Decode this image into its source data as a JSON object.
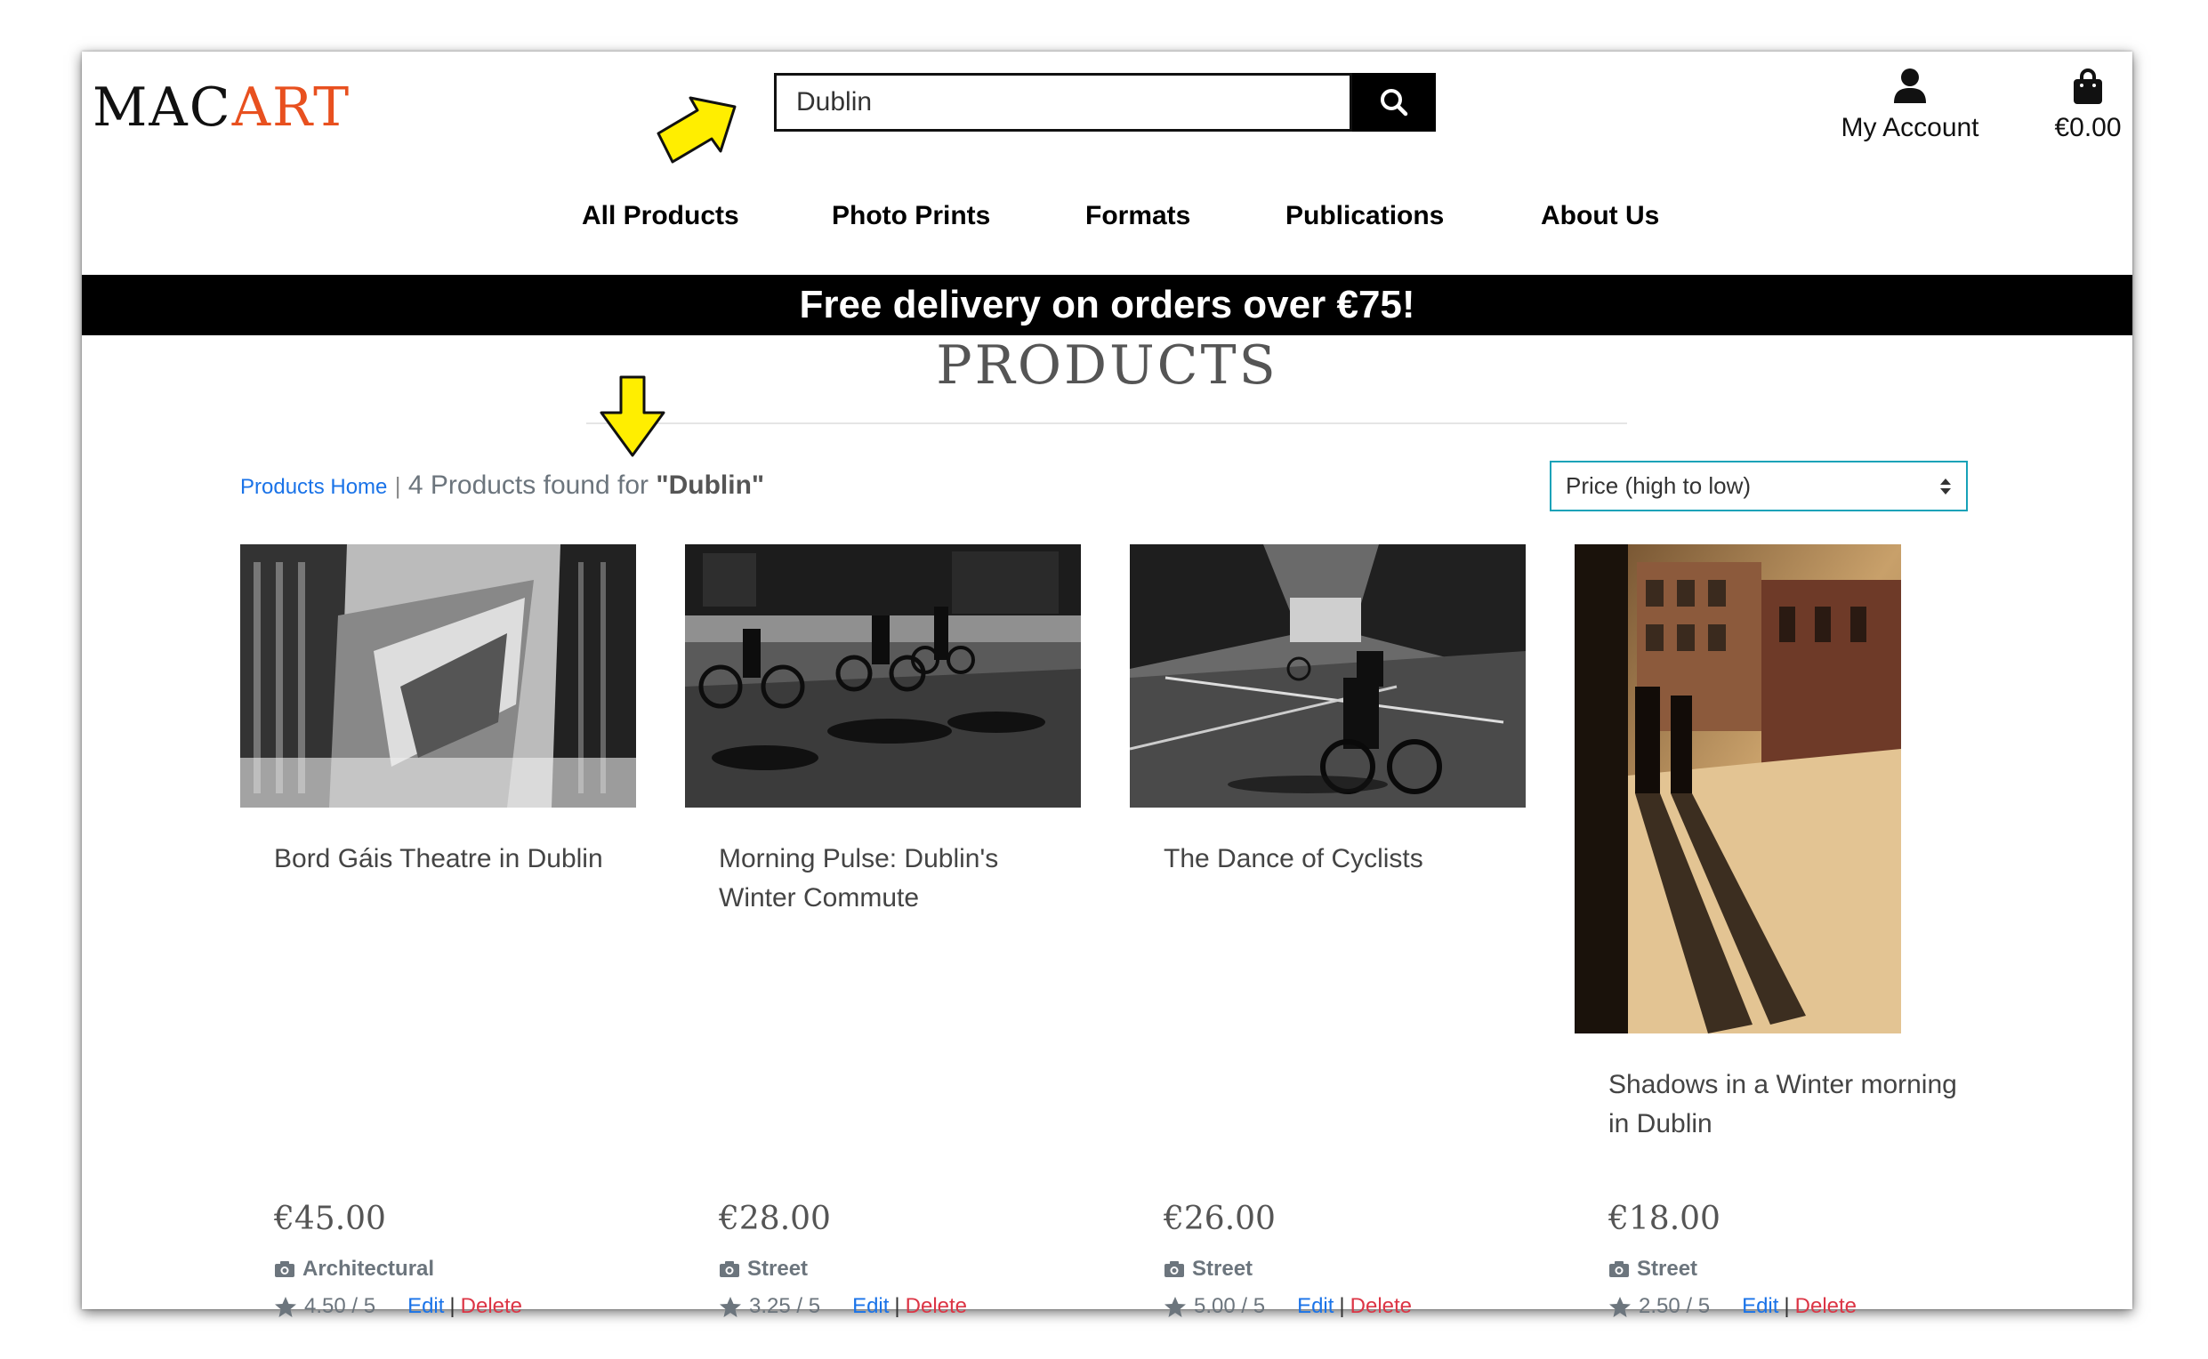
{
  "brand": {
    "part1": "MAC",
    "part2": "ART",
    "accent_color": "#e8501f"
  },
  "search": {
    "value": "Dublin",
    "button_icon": "search-icon"
  },
  "header": {
    "account_label": "My Account",
    "account_icon": "user-icon",
    "bag_label": "€0.00",
    "bag_icon": "shopping-bag-icon"
  },
  "nav": {
    "items": [
      "All Products",
      "Photo Prints",
      "Formats",
      "Publications",
      "About Us"
    ]
  },
  "banner": {
    "text": "Free delivery on orders over €75!"
  },
  "page": {
    "title": "PRODUCTS"
  },
  "results": {
    "home_link": "Products Home",
    "separator": "|",
    "summary": "4 Products found for",
    "query": "\"Dublin\""
  },
  "sort": {
    "selected": "Price (high to low)"
  },
  "products": [
    {
      "name": "Bord Gáis Theatre in Dublin",
      "price": "€45.00",
      "category": "Architectural",
      "rating": "4.50 / 5",
      "edit": "Edit",
      "sep": "|",
      "delete": "Delete"
    },
    {
      "name": "Morning Pulse: Dublin's Winter Commute",
      "price": "€28.00",
      "category": "Street",
      "rating": "3.25 / 5",
      "edit": "Edit",
      "sep": "|",
      "delete": "Delete"
    },
    {
      "name": "The Dance of Cyclists",
      "price": "€26.00",
      "category": "Street",
      "rating": "5.00 / 5",
      "edit": "Edit",
      "sep": "|",
      "delete": "Delete"
    },
    {
      "name": "Shadows in a Winter morning in Dublin",
      "price": "€18.00",
      "category": "Street",
      "rating": "2.50 / 5",
      "edit": "Edit",
      "sep": "|",
      "delete": "Delete"
    }
  ],
  "colors": {
    "link": "#1a73e8",
    "delete": "#dc3545",
    "banner_bg": "#000000",
    "sort_border": "#17a2b8",
    "annotation_arrow": "#ffee00"
  }
}
